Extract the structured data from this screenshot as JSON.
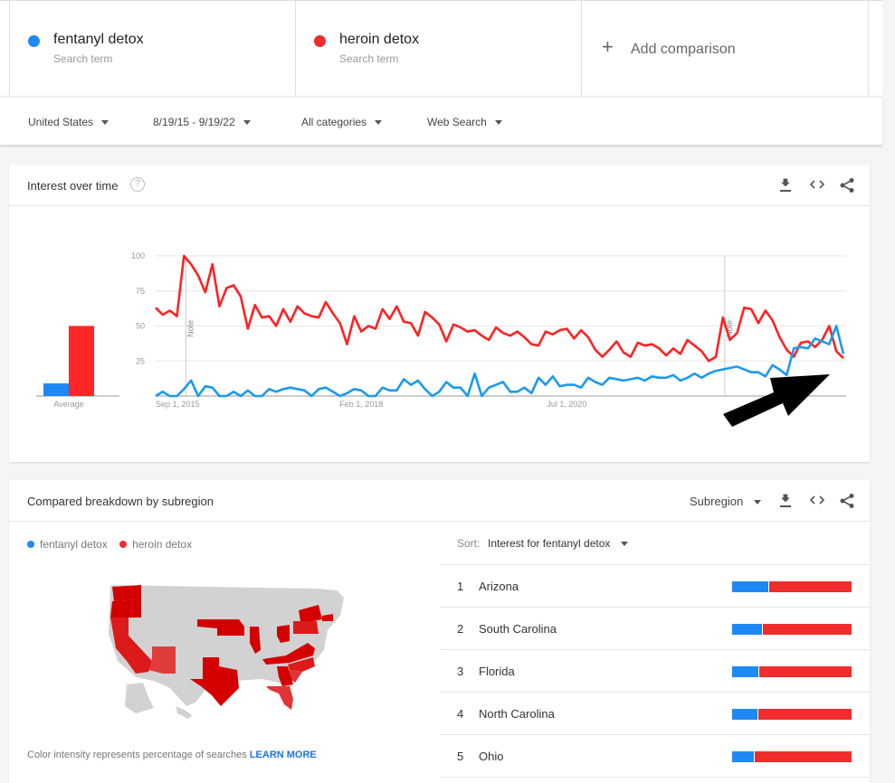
{
  "search_terms": [
    {
      "name": "fentanyl detox",
      "subtitle": "Search term",
      "color": "#1e88f5"
    },
    {
      "name": "heroin detox",
      "subtitle": "Search term",
      "color": "#ef2d2d"
    }
  ],
  "add_comparison": {
    "icon": "plus-icon",
    "label": "Add comparison"
  },
  "filters": {
    "region": "United States",
    "date_range": "8/19/15 - 9/19/22",
    "category": "All categories",
    "search_type": "Web Search"
  },
  "interest_over_time": {
    "title": "Interest over time",
    "help_icon": "?",
    "actions": [
      "download-icon",
      "embed-icon",
      "share-icon"
    ],
    "average_label": "Average",
    "note_label": "Note"
  },
  "chart_data": {
    "type": "line",
    "title": "Interest over time",
    "xlabel": "",
    "ylabel": "",
    "ylim": [
      0,
      100
    ],
    "yticks": [
      25,
      50,
      75,
      100
    ],
    "xtick_labels": [
      "Sep 1, 2015",
      "Feb 1, 2018",
      "Jul 1, 2020"
    ],
    "x_start": "Sep 2015",
    "x_end": "Sep 2022",
    "grid": true,
    "annotations": [
      {
        "label": "Note",
        "at": "Jan 2016"
      },
      {
        "label": "Note",
        "at": "Jan 2022"
      }
    ],
    "averages": [
      {
        "name": "fentanyl detox",
        "value": 9
      },
      {
        "name": "heroin detox",
        "value": 50
      }
    ],
    "series": [
      {
        "name": "heroin detox",
        "color": "#ef2d2d",
        "values": [
          63,
          58,
          61,
          57,
          100,
          94,
          86,
          74,
          94,
          64,
          77,
          79,
          71,
          48,
          65,
          56,
          57,
          50,
          62,
          53,
          64,
          59,
          57,
          56,
          67,
          59,
          52,
          37,
          57,
          46,
          50,
          48,
          62,
          55,
          64,
          53,
          52,
          43,
          60,
          56,
          51,
          39,
          51,
          49,
          46,
          47,
          43,
          40,
          49,
          45,
          43,
          46,
          42,
          37,
          36,
          46,
          44,
          47,
          48,
          41,
          47,
          42,
          33,
          28,
          33,
          39,
          31,
          28,
          38,
          36,
          37,
          34,
          29,
          34,
          30,
          40,
          36,
          32,
          25,
          28,
          56,
          40,
          45,
          63,
          62,
          52,
          61,
          54,
          42,
          33,
          28,
          38,
          39,
          35,
          40,
          50,
          32,
          27
        ]
      },
      {
        "name": "fentanyl detox",
        "color": "#1e88f5",
        "values": [
          0,
          3,
          0,
          0,
          5,
          11,
          0,
          7,
          6,
          0,
          0,
          3,
          0,
          4,
          0,
          0,
          5,
          3,
          5,
          6,
          5,
          4,
          0,
          5,
          6,
          3,
          0,
          2,
          5,
          4,
          0,
          0,
          6,
          4,
          4,
          12,
          8,
          11,
          5,
          0,
          3,
          10,
          6,
          6,
          0,
          16,
          0,
          6,
          8,
          10,
          3,
          3,
          6,
          2,
          13,
          8,
          14,
          7,
          8,
          8,
          6,
          13,
          10,
          8,
          13,
          12,
          11,
          12,
          13,
          11,
          14,
          13,
          13,
          15,
          11,
          13,
          16,
          13,
          16,
          18,
          19,
          20,
          21,
          19,
          17,
          17,
          14,
          22,
          19,
          15,
          34,
          35,
          34,
          41,
          39,
          37,
          50,
          30
        ]
      }
    ]
  },
  "subregion": {
    "title": "Compared breakdown by subregion",
    "view_selector": "Subregion",
    "actions": [
      "download-icon",
      "embed-icon",
      "share-icon"
    ],
    "legend": [
      "fentanyl detox",
      "heroin detox"
    ],
    "sort_label": "Sort:",
    "sort_value": "Interest for fentanyl detox",
    "rows": [
      {
        "rank": "1",
        "region": "Arizona",
        "fentanyl_share": 0.3
      },
      {
        "rank": "2",
        "region": "South Carolina",
        "fentanyl_share": 0.25
      },
      {
        "rank": "3",
        "region": "Florida",
        "fentanyl_share": 0.22
      },
      {
        "rank": "4",
        "region": "North Carolina",
        "fentanyl_share": 0.21
      },
      {
        "rank": "5",
        "region": "Ohio",
        "fentanyl_share": 0.18
      }
    ],
    "footnote": "Color intensity represents percentage of searches",
    "learn_more": "LEARN MORE"
  }
}
